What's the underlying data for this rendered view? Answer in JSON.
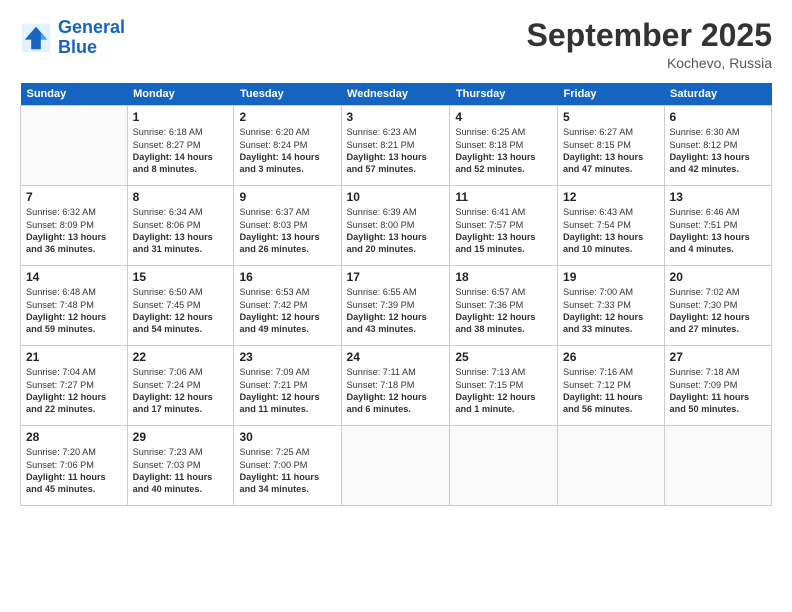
{
  "logo": {
    "line1": "General",
    "line2": "Blue"
  },
  "title": "September 2025",
  "location": "Kochevo, Russia",
  "days_header": [
    "Sunday",
    "Monday",
    "Tuesday",
    "Wednesday",
    "Thursday",
    "Friday",
    "Saturday"
  ],
  "weeks": [
    [
      {
        "num": "",
        "empty": true
      },
      {
        "num": "1",
        "sunrise": "6:18 AM",
        "sunset": "8:27 PM",
        "daylight": "14 hours and 8 minutes."
      },
      {
        "num": "2",
        "sunrise": "6:20 AM",
        "sunset": "8:24 PM",
        "daylight": "14 hours and 3 minutes."
      },
      {
        "num": "3",
        "sunrise": "6:23 AM",
        "sunset": "8:21 PM",
        "daylight": "13 hours and 57 minutes."
      },
      {
        "num": "4",
        "sunrise": "6:25 AM",
        "sunset": "8:18 PM",
        "daylight": "13 hours and 52 minutes."
      },
      {
        "num": "5",
        "sunrise": "6:27 AM",
        "sunset": "8:15 PM",
        "daylight": "13 hours and 47 minutes."
      },
      {
        "num": "6",
        "sunrise": "6:30 AM",
        "sunset": "8:12 PM",
        "daylight": "13 hours and 42 minutes."
      }
    ],
    [
      {
        "num": "7",
        "sunrise": "6:32 AM",
        "sunset": "8:09 PM",
        "daylight": "13 hours and 36 minutes."
      },
      {
        "num": "8",
        "sunrise": "6:34 AM",
        "sunset": "8:06 PM",
        "daylight": "13 hours and 31 minutes."
      },
      {
        "num": "9",
        "sunrise": "6:37 AM",
        "sunset": "8:03 PM",
        "daylight": "13 hours and 26 minutes."
      },
      {
        "num": "10",
        "sunrise": "6:39 AM",
        "sunset": "8:00 PM",
        "daylight": "13 hours and 20 minutes."
      },
      {
        "num": "11",
        "sunrise": "6:41 AM",
        "sunset": "7:57 PM",
        "daylight": "13 hours and 15 minutes."
      },
      {
        "num": "12",
        "sunrise": "6:43 AM",
        "sunset": "7:54 PM",
        "daylight": "13 hours and 10 minutes."
      },
      {
        "num": "13",
        "sunrise": "6:46 AM",
        "sunset": "7:51 PM",
        "daylight": "13 hours and 4 minutes."
      }
    ],
    [
      {
        "num": "14",
        "sunrise": "6:48 AM",
        "sunset": "7:48 PM",
        "daylight": "12 hours and 59 minutes."
      },
      {
        "num": "15",
        "sunrise": "6:50 AM",
        "sunset": "7:45 PM",
        "daylight": "12 hours and 54 minutes."
      },
      {
        "num": "16",
        "sunrise": "6:53 AM",
        "sunset": "7:42 PM",
        "daylight": "12 hours and 49 minutes."
      },
      {
        "num": "17",
        "sunrise": "6:55 AM",
        "sunset": "7:39 PM",
        "daylight": "12 hours and 43 minutes."
      },
      {
        "num": "18",
        "sunrise": "6:57 AM",
        "sunset": "7:36 PM",
        "daylight": "12 hours and 38 minutes."
      },
      {
        "num": "19",
        "sunrise": "7:00 AM",
        "sunset": "7:33 PM",
        "daylight": "12 hours and 33 minutes."
      },
      {
        "num": "20",
        "sunrise": "7:02 AM",
        "sunset": "7:30 PM",
        "daylight": "12 hours and 27 minutes."
      }
    ],
    [
      {
        "num": "21",
        "sunrise": "7:04 AM",
        "sunset": "7:27 PM",
        "daylight": "12 hours and 22 minutes."
      },
      {
        "num": "22",
        "sunrise": "7:06 AM",
        "sunset": "7:24 PM",
        "daylight": "12 hours and 17 minutes."
      },
      {
        "num": "23",
        "sunrise": "7:09 AM",
        "sunset": "7:21 PM",
        "daylight": "12 hours and 11 minutes."
      },
      {
        "num": "24",
        "sunrise": "7:11 AM",
        "sunset": "7:18 PM",
        "daylight": "12 hours and 6 minutes."
      },
      {
        "num": "25",
        "sunrise": "7:13 AM",
        "sunset": "7:15 PM",
        "daylight": "12 hours and 1 minute."
      },
      {
        "num": "26",
        "sunrise": "7:16 AM",
        "sunset": "7:12 PM",
        "daylight": "11 hours and 56 minutes."
      },
      {
        "num": "27",
        "sunrise": "7:18 AM",
        "sunset": "7:09 PM",
        "daylight": "11 hours and 50 minutes."
      }
    ],
    [
      {
        "num": "28",
        "sunrise": "7:20 AM",
        "sunset": "7:06 PM",
        "daylight": "11 hours and 45 minutes."
      },
      {
        "num": "29",
        "sunrise": "7:23 AM",
        "sunset": "7:03 PM",
        "daylight": "11 hours and 40 minutes."
      },
      {
        "num": "30",
        "sunrise": "7:25 AM",
        "sunset": "7:00 PM",
        "daylight": "11 hours and 34 minutes."
      },
      {
        "num": "",
        "empty": true
      },
      {
        "num": "",
        "empty": true
      },
      {
        "num": "",
        "empty": true
      },
      {
        "num": "",
        "empty": true
      }
    ]
  ]
}
